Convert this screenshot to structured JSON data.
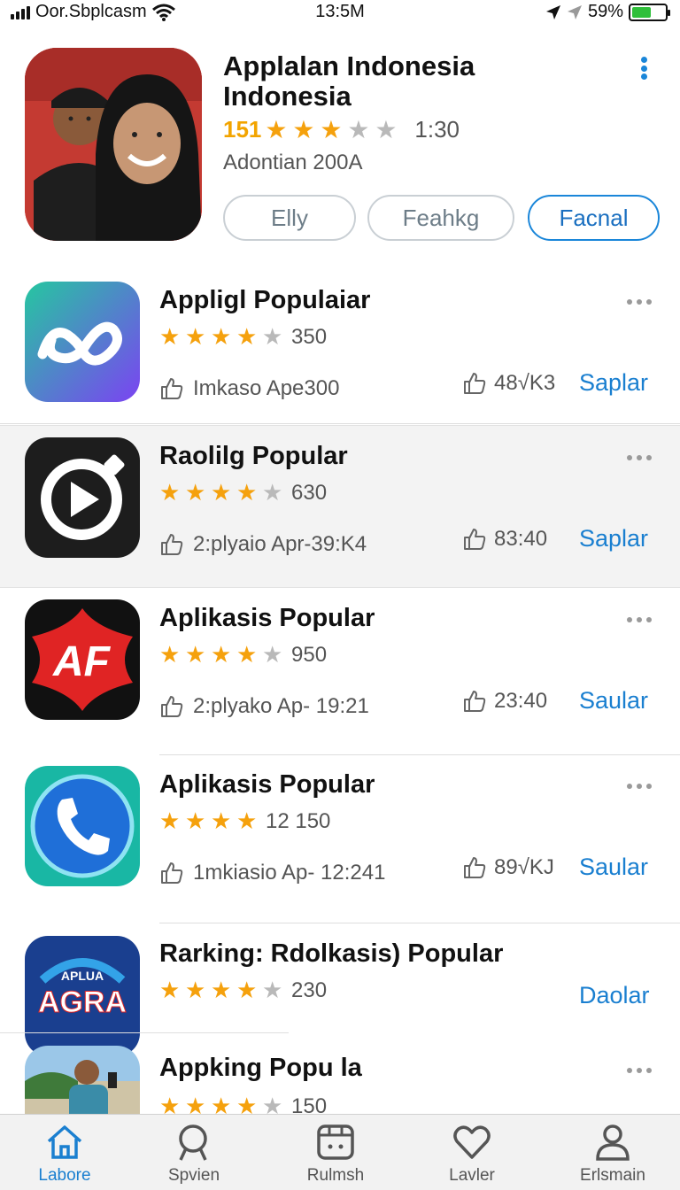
{
  "status_bar": {
    "carrier": "Oor.Sbplcasm",
    "time": "13:5M",
    "battery": "59%",
    "battery_level": 0.59
  },
  "featured": {
    "title": "Applalan Indonesia Indonesia",
    "rating_number": "151",
    "rating_stars": 3,
    "rating_after": "1:30",
    "subtitle": "Adontian 200A",
    "pills": [
      "Elly",
      "Feahkg",
      "Facnal"
    ],
    "active_pill": 2,
    "more_icon": "vertical-dots-icon"
  },
  "apps": [
    {
      "title": "Appligl Populaiar",
      "stars": 4,
      "rating_count": "350",
      "meta_left": "Imkaso Ape300",
      "meta_right": "48√K3",
      "action": "Saplar",
      "icon": "infinity-logo-icon",
      "icon_colors": [
        "#25c7a0",
        "#7b43f2"
      ]
    },
    {
      "title": "Raolilg Popular",
      "stars": 4,
      "rating_count": "630",
      "meta_left": "2:plyaio  Apr-39:K4",
      "meta_right": "83:40",
      "action": "Saplar",
      "icon": "play-button-icon",
      "icon_colors": [
        "#1d1d1d"
      ]
    },
    {
      "title": "Aplikasis Popular",
      "stars": 4,
      "rating_count": "950",
      "meta_left": "2:plyako  Ap- 19:21",
      "meta_right": "23:40",
      "action": "Saular",
      "icon": "af-logo-icon",
      "icon_colors": [
        "#e02424",
        "#111111"
      ]
    },
    {
      "title": "Aplikasis Popular",
      "stars": 4,
      "rating_count": "12 150",
      "meta_left": "1mkiasio  Ap- 12:241",
      "meta_right": "89√KJ",
      "action": "Saular",
      "icon": "phone-call-icon",
      "icon_colors": [
        "#19b7a4",
        "#1f6fd8"
      ]
    },
    {
      "title": "Rarking: Rdolkasis) Popular",
      "stars": 4,
      "rating_count": "230",
      "action": "Daolar",
      "icon": "agra-logo-icon",
      "icon_text": "AGRA",
      "icon_subtext": "APLUA",
      "icon_colors": [
        "#1a3f8f",
        "#e02424"
      ]
    },
    {
      "title": "Appking Popu la",
      "stars": 4,
      "rating_count": "150",
      "icon": "person-photo-icon",
      "icon_colors": [
        "#9bc7e8",
        "#3f7a3a"
      ]
    }
  ],
  "tabs": [
    {
      "label": "Labore",
      "icon": "home-icon"
    },
    {
      "label": "Spvien",
      "icon": "search-icon"
    },
    {
      "label": "Rulmsh",
      "icon": "calendar-icon"
    },
    {
      "label": "Lavler",
      "icon": "heart-icon"
    },
    {
      "label": "Erlsmain",
      "icon": "person-icon"
    }
  ],
  "active_tab": 0,
  "colors": {
    "accent": "#1a86d9",
    "star": "#f5a10d",
    "battery": "#2fbf3a"
  }
}
